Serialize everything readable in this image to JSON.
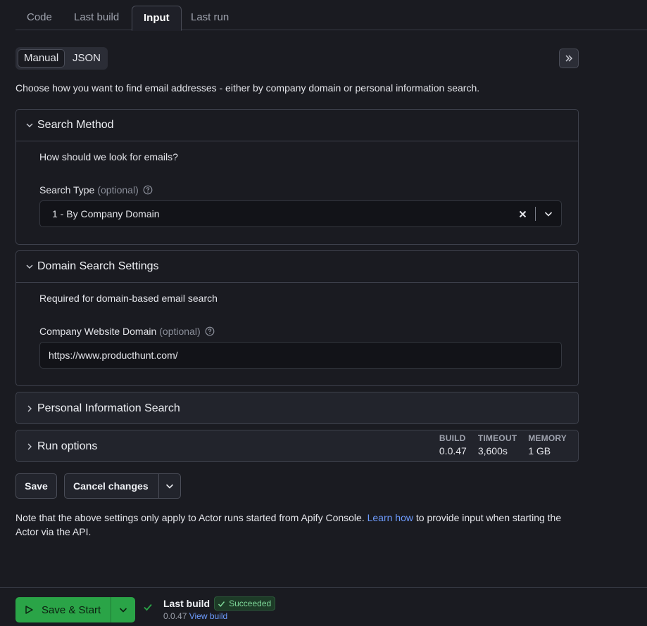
{
  "tabs": [
    {
      "label": "Code"
    },
    {
      "label": "Last build"
    },
    {
      "label": "Input"
    },
    {
      "label": "Last run"
    }
  ],
  "mode_toggle": {
    "manual": "Manual",
    "json": "JSON"
  },
  "intro_text": "Choose how you want to find email addresses - either by company domain or personal information search.",
  "sections": {
    "search_method": {
      "title": "Search Method",
      "description": "How should we look for emails?",
      "field_label": "Search Type",
      "optional": "(optional)",
      "value": "1 - By Company Domain"
    },
    "domain_settings": {
      "title": "Domain Search Settings",
      "description": "Required for domain-based email search",
      "field_label": "Company Website Domain",
      "optional": "(optional)",
      "value": "https://www.producthunt.com/"
    },
    "personal_info": {
      "title": "Personal Information Search"
    },
    "run_options": {
      "title": "Run options",
      "stats": [
        {
          "key": "BUILD",
          "value": "0.0.47"
        },
        {
          "key": "TIMEOUT",
          "value": "3,600s"
        },
        {
          "key": "MEMORY",
          "value": "1 GB"
        }
      ]
    }
  },
  "actions": {
    "save": "Save",
    "cancel": "Cancel changes"
  },
  "note": {
    "before": "Note that the above settings only apply to Actor runs started from Apify Console. ",
    "link": "Learn how",
    "after": " to provide input when starting the Actor via the API."
  },
  "footer": {
    "start_label": "Save & Start",
    "last_build_label": "Last build",
    "status": "Succeeded",
    "version": "0.0.47",
    "view_build": "View build"
  },
  "colors": {
    "accent_green": "#2aa447",
    "link_blue": "#6e9cff",
    "success_text": "#7fd99a"
  }
}
